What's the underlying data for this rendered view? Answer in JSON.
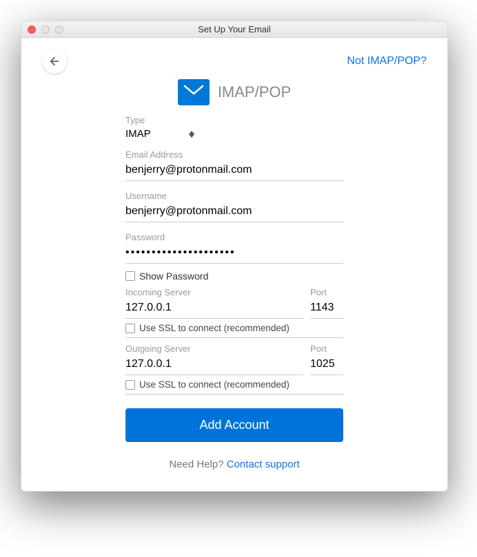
{
  "window": {
    "title": "Set Up Your Email"
  },
  "header": {
    "not_imap": "Not IMAP/POP?"
  },
  "heading": {
    "text": "IMAP/POP"
  },
  "form": {
    "type_label": "Type",
    "type_value": "IMAP",
    "email_label": "Email Address",
    "email_value": "benjerry@protonmail.com",
    "username_label": "Username",
    "username_value": "benjerry@protonmail.com",
    "password_label": "Password",
    "password_value": "•••••••••••••••••••••",
    "show_password": "Show Password",
    "incoming_label": "Incoming Server",
    "incoming_value": "127.0.0.1",
    "incoming_port_label": "Port",
    "incoming_port_value": "1143",
    "incoming_ssl": "Use SSL to connect (recommended)",
    "outgoing_label": "Outgoing Server",
    "outgoing_value": "127.0.0.1",
    "outgoing_port_label": "Port",
    "outgoing_port_value": "1025",
    "outgoing_ssl": "Use SSL to connect (recommended)",
    "add_button": "Add Account"
  },
  "footer": {
    "help_text": "Need Help? ",
    "contact": "Contact support"
  }
}
